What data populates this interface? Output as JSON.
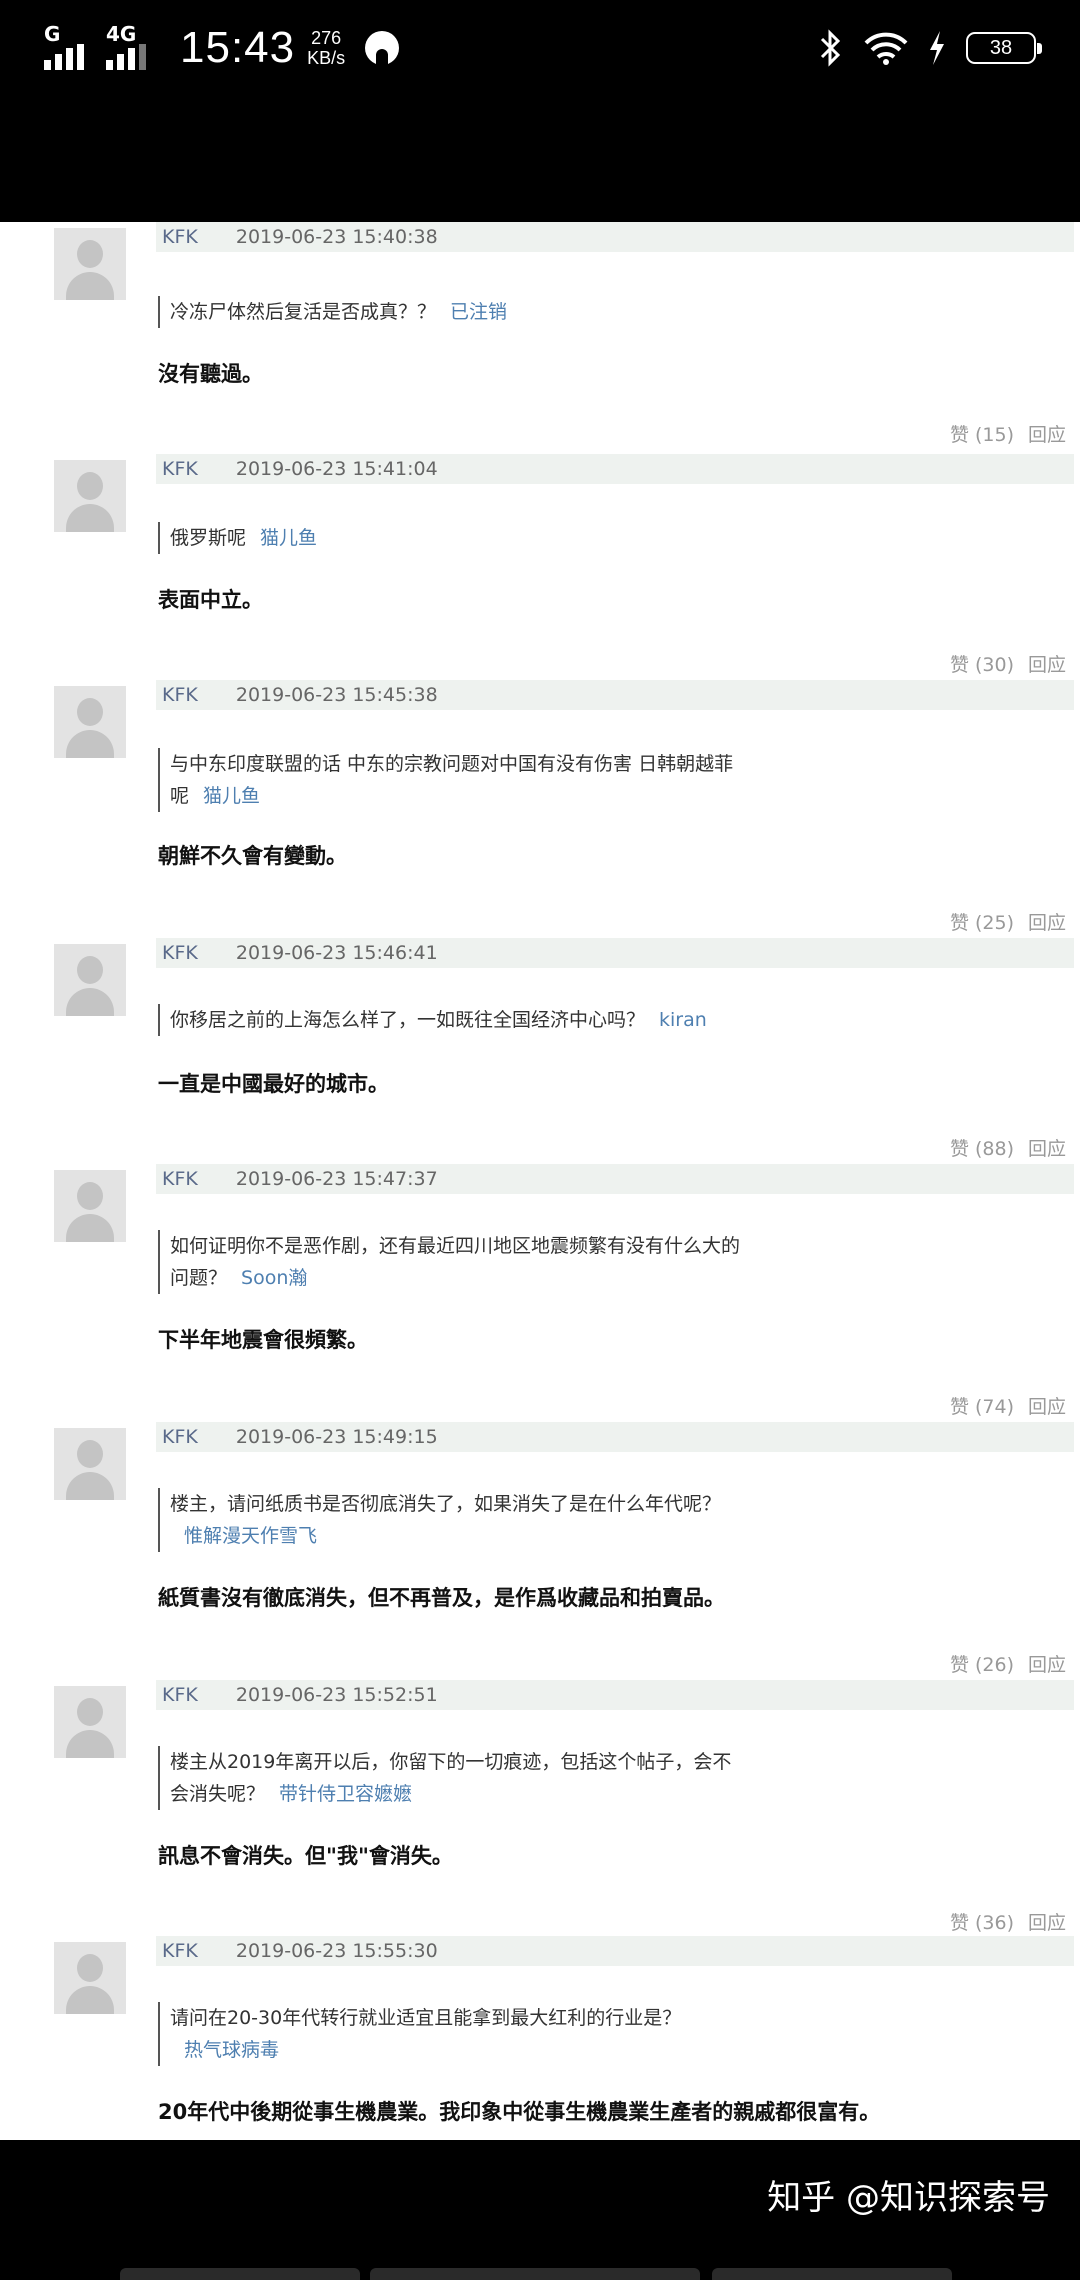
{
  "status_bar": {
    "network_label": "G",
    "network_label2": "4G",
    "time": "15:43",
    "speed_value": "276",
    "speed_unit": "KB/s",
    "battery": "38",
    "icons": [
      "signal-icon",
      "signal-4g-icon",
      "app-notification-icon",
      "bluetooth-icon",
      "wifi-icon",
      "charging-icon",
      "battery-icon"
    ]
  },
  "comments": [
    {
      "user": "KFK",
      "date": "2019-06-23 15:40:38",
      "quote_lines": [
        "冷冻尸体然后复活是否成真？？"
      ],
      "quote_author": "已注销",
      "reply": "沒有聽過。",
      "likes": "赞 (15)",
      "reply_btn": "回应"
    },
    {
      "user": "KFK",
      "date": "2019-06-23 15:41:04",
      "quote_lines": [
        "俄罗斯呢"
      ],
      "quote_author": "猫儿鱼",
      "reply": "表面中立。",
      "likes": "赞 (30)",
      "reply_btn": "回应"
    },
    {
      "user": "KFK",
      "date": "2019-06-23 15:45:38",
      "quote_lines": [
        "与中东印度联盟的话 中东的宗教问题对中国有没有伤害 日韩朝越菲",
        "呢"
      ],
      "quote_author": "猫儿鱼",
      "reply": "朝鮮不久會有變動。",
      "likes": "赞 (25)",
      "reply_btn": "回应"
    },
    {
      "user": "KFK",
      "date": "2019-06-23 15:46:41",
      "quote_lines": [
        "你移居之前的上海怎么样了，一如既往全国经济中心吗？"
      ],
      "quote_author": "kiran",
      "reply": "一直是中國最好的城市。",
      "likes": "赞 (88)",
      "reply_btn": "回应"
    },
    {
      "user": "KFK",
      "date": "2019-06-23 15:47:37",
      "quote_lines": [
        "如何证明你不是恶作剧，还有最近四川地区地震频繁有没有什么大的",
        "问题？"
      ],
      "quote_author": "Soon瀚",
      "reply": "下半年地震會很頻繁。",
      "likes": "赞 (74)",
      "reply_btn": "回应"
    },
    {
      "user": "KFK",
      "date": "2019-06-23 15:49:15",
      "quote_lines": [
        "楼主，请问纸质书是否彻底消失了，如果消失了是在什么年代呢？",
        ""
      ],
      "quote_author": "惟解漫天作雪飞",
      "reply": "紙質書沒有徹底消失，但不再普及，是作爲收藏品和拍賣品。",
      "likes": "赞 (26)",
      "reply_btn": "回应"
    },
    {
      "user": "KFK",
      "date": "2019-06-23 15:52:51",
      "quote_lines": [
        "楼主从2019年离开以后，你留下的一切痕迹，包括这个帖子，会不",
        "会消失呢？"
      ],
      "quote_author": "带针侍卫容嬷嬷",
      "reply": "訊息不會消失。但\"我\"會消失。",
      "likes": "赞 (36)",
      "reply_btn": "回应"
    },
    {
      "user": "KFK",
      "date": "2019-06-23 15:55:30",
      "quote_lines": [
        "请问在20-30年代转行就业适宜且能拿到最大红利的行业是？",
        ""
      ],
      "quote_author": "热气球病毒",
      "reply": "20年代中後期從事生機農業。我印象中從事生機農業生產者的親戚都很富有。",
      "likes": "",
      "reply_btn": ""
    }
  ],
  "watermark": "知乎 @知识探索号"
}
